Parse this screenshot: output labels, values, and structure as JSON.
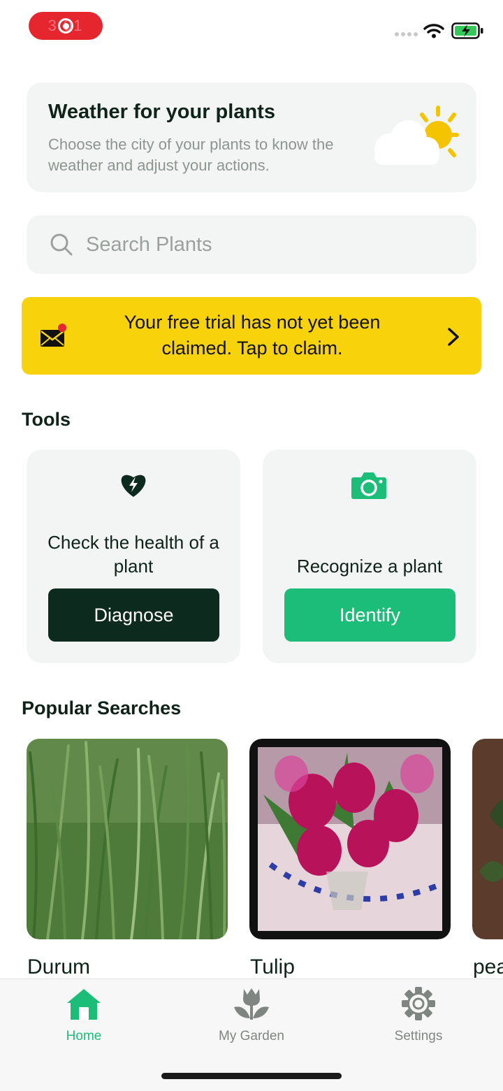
{
  "status_bar": {
    "recording_time": "3:01"
  },
  "weather": {
    "title": "Weather for your plants",
    "description": "Choose the city of your plants to know the weather and adjust your actions."
  },
  "search": {
    "placeholder": "Search Plants"
  },
  "trial_banner": {
    "text": "Your free trial has not yet been claimed. Tap to claim."
  },
  "tools": {
    "title": "Tools",
    "diagnose": {
      "description": "Check the health of a plant",
      "button": "Diagnose"
    },
    "identify": {
      "description": "Recognize a plant",
      "button": "Identify"
    }
  },
  "popular": {
    "title": "Popular Searches",
    "items": [
      {
        "name": "Durum"
      },
      {
        "name": "Tulip"
      },
      {
        "name": "pea"
      }
    ]
  },
  "tab_bar": {
    "items": [
      {
        "label": "Home",
        "active": true
      },
      {
        "label": "My Garden",
        "active": false
      },
      {
        "label": "Settings",
        "active": false
      }
    ]
  },
  "colors": {
    "accent_green": "#1cbd79",
    "dark_green": "#0d2a1e",
    "banner_yellow": "#f8d20b",
    "card_bg": "#f3f5f4"
  }
}
